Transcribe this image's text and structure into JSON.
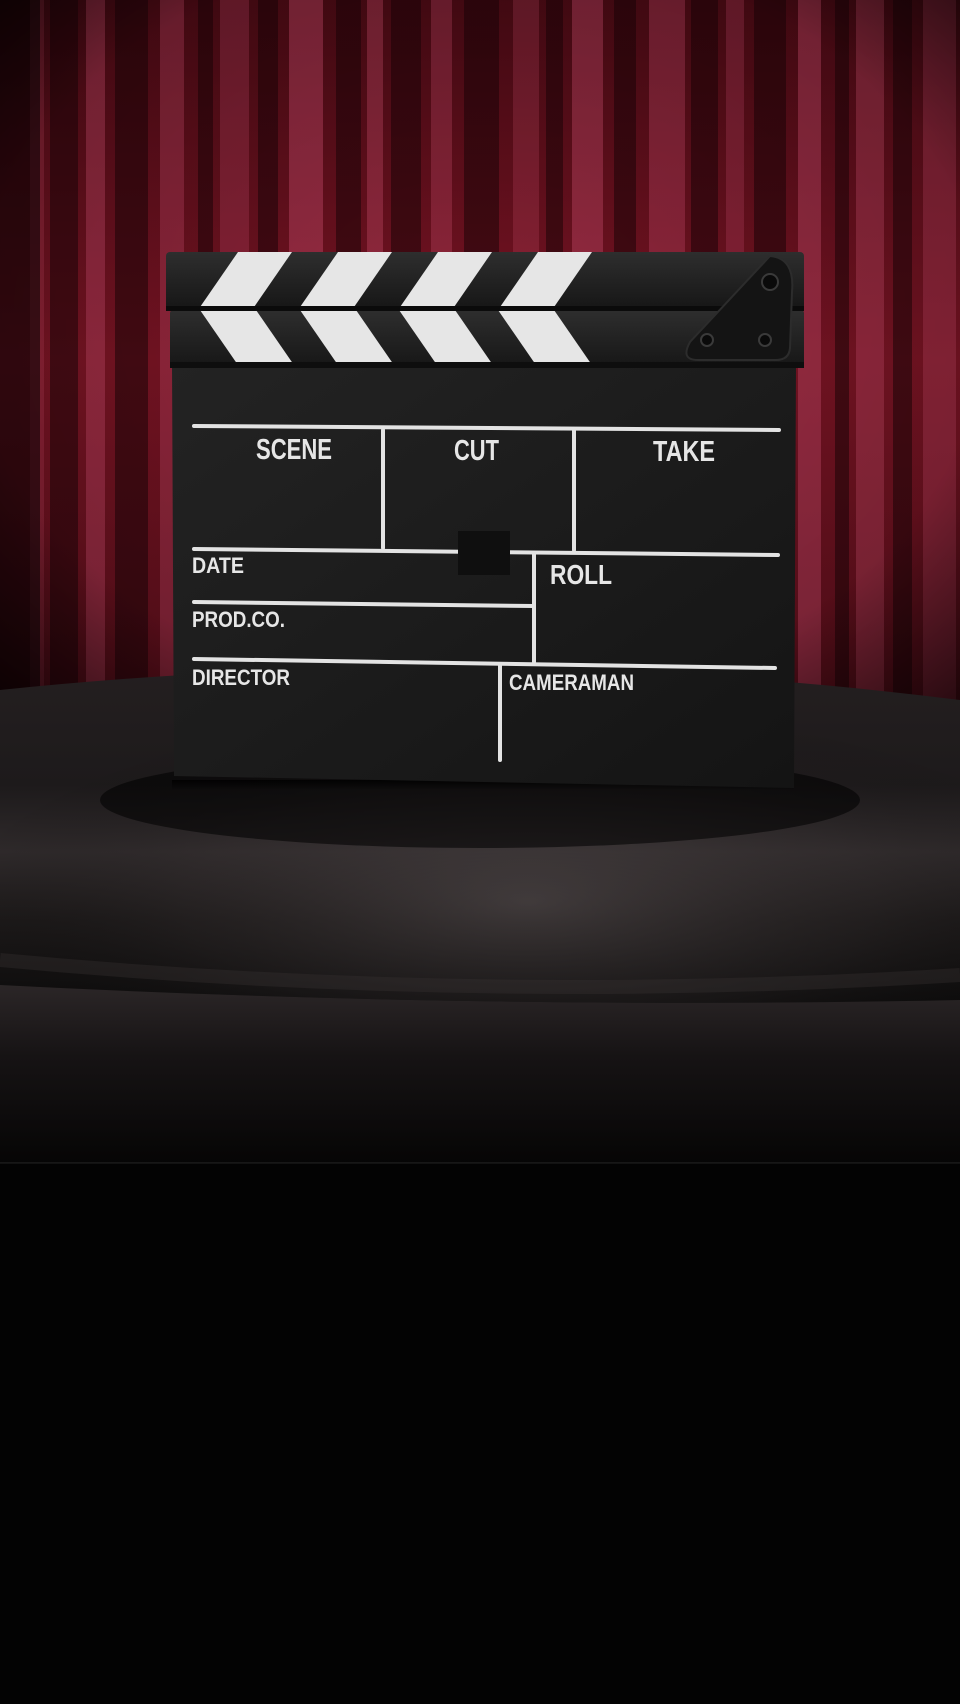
{
  "slate": {
    "labels": {
      "scene": "SCENE",
      "cut": "CUT",
      "take": "TAKE",
      "date": "DATE",
      "roll": "ROLL",
      "prod_co": "PROD.CO.",
      "director": "DIRECTOR",
      "cameraman": "CAMERAMAN"
    }
  },
  "colors": {
    "curtain": "#7a1424",
    "curtain_highlight": "#c24866",
    "table_cloth": "#1c1819",
    "slate_body": "#1b1b1b",
    "slate_lines": "#e6e6e6",
    "background": "#030303"
  }
}
